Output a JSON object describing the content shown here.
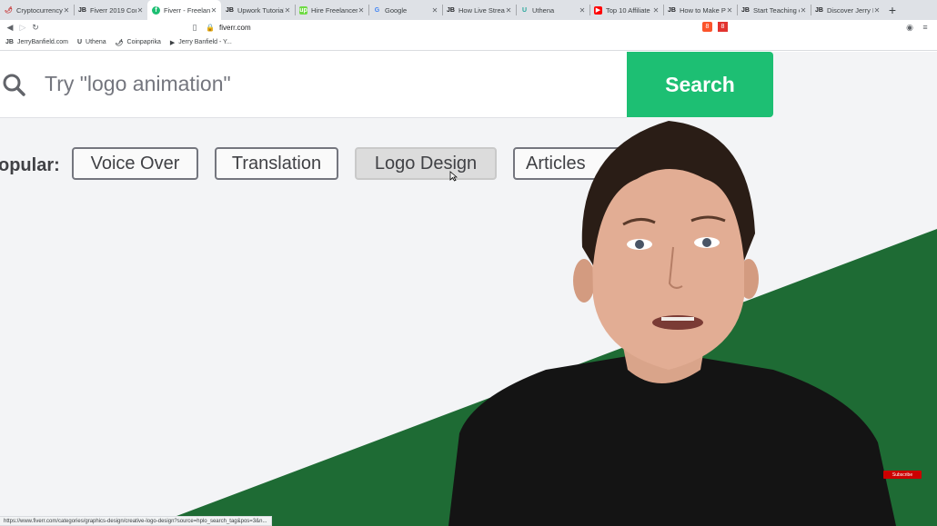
{
  "browser": {
    "tabs": [
      {
        "icon": "chili-icon",
        "icon_text": "🌶",
        "title": "Cryptocurrency I"
      },
      {
        "icon": "jb-icon",
        "icon_text": "JB",
        "title": "Fiverr 2019 Com"
      },
      {
        "icon": "fiverr-icon",
        "icon_text": "f",
        "title": "Fiverr - Freelanc",
        "active": true
      },
      {
        "icon": "jb-icon",
        "icon_text": "JB",
        "title": "Upwork Tutorial"
      },
      {
        "icon": "upwork-icon",
        "icon_text": "up",
        "title": "Hire Freelancers"
      },
      {
        "icon": "google-icon",
        "icon_text": "G",
        "title": "Google"
      },
      {
        "icon": "jb-icon",
        "icon_text": "JB",
        "title": "How Live Stream"
      },
      {
        "icon": "uthena-icon",
        "icon_text": "U",
        "title": "Uthena"
      },
      {
        "icon": "youtube-icon",
        "icon_text": "▶",
        "title": "Top 10 Affiliate M"
      },
      {
        "icon": "jb-icon",
        "icon_text": "JB",
        "title": "How to Make Pa"
      },
      {
        "icon": "jb-icon",
        "icon_text": "JB",
        "title": "Start Teaching o"
      },
      {
        "icon": "jb-icon",
        "icon_text": "JB",
        "title": "Discover Jerry B"
      }
    ],
    "new_tab": "+",
    "tab_close": "✕",
    "url": "fiverr.com",
    "bookmarks": [
      {
        "icon_text": "JB",
        "label": "JerryBanfield.com"
      },
      {
        "icon_text": "U",
        "label": "Uthena"
      },
      {
        "icon_text": "🌶",
        "label": "Coinpaprika"
      },
      {
        "icon_text": "▶",
        "label": "Jerry Banfield - Y..."
      }
    ],
    "extension_badges": [
      "8",
      "8"
    ],
    "status_url": "https://www.fiverr.com/categories/graphics-design/creative-logo-design?source=hplo_search_tag&pos=3&n..."
  },
  "page": {
    "search": {
      "placeholder": "Try \"logo animation\"",
      "button_label": "Search"
    },
    "popular": {
      "label": "opular:",
      "tags": [
        "Voice Over",
        "Translation",
        "Logo Design",
        "Articles"
      ]
    },
    "subscribe_label": "Subscribe"
  },
  "colors": {
    "fiverr_green": "#1dbf73",
    "dark_green": "#1e6b34",
    "page_bg": "#f3f4f6"
  }
}
